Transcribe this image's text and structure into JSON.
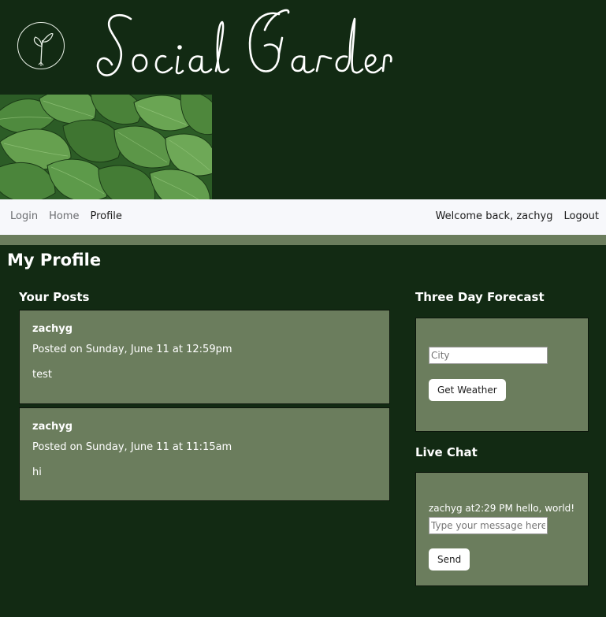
{
  "header": {
    "brand_name": "Social Garden",
    "logo_icon": "sprout-icon"
  },
  "nav": {
    "items": [
      {
        "label": "Login"
      },
      {
        "label": "Home"
      },
      {
        "label": "Profile"
      }
    ],
    "welcome": "Welcome back, zachyg",
    "logout": "Logout"
  },
  "page": {
    "title": "My Profile"
  },
  "posts": {
    "heading": "Your Posts",
    "items": [
      {
        "author": "zachyg",
        "date": "Posted on Sunday, June 11 at 12:59pm",
        "body": "test"
      },
      {
        "author": "zachyg",
        "date": "Posted on Sunday, June 11 at 11:15am",
        "body": "hi"
      }
    ]
  },
  "forecast": {
    "heading": "Three Day Forecast",
    "city_placeholder": "City",
    "button": "Get Weather"
  },
  "chat": {
    "heading": "Live Chat",
    "messages": [
      {
        "text": "zachyg at2:29 PM hello, world!"
      }
    ],
    "input_placeholder": "Type your message here...",
    "send": "Send"
  },
  "colors": {
    "background": "#122a13",
    "card": "#6b7d5d",
    "navbar": "#f7f8fb"
  }
}
